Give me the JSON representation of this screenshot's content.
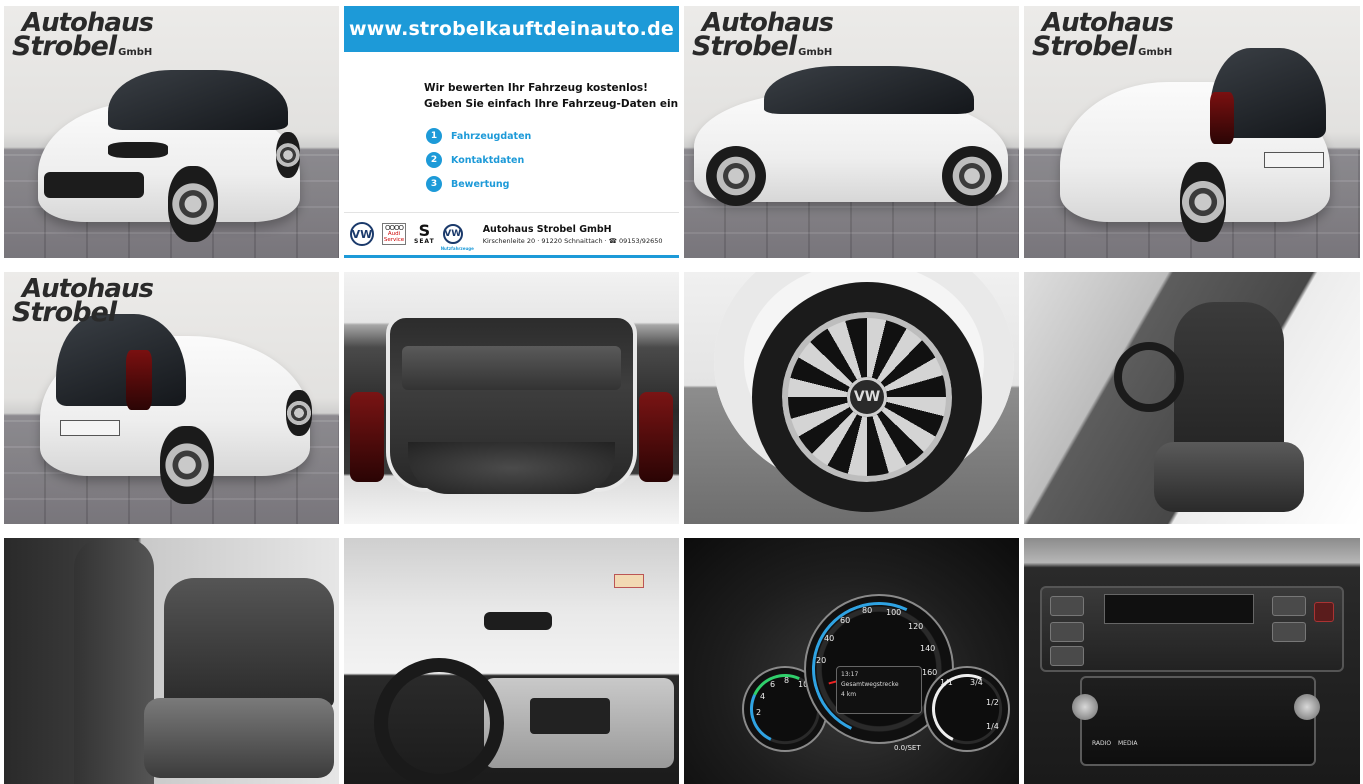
{
  "dealer_logo": {
    "line1": "Autohaus",
    "line2": "Strobel",
    "line3": "GmbH"
  },
  "banner": {
    "url": "www.strobelkauftdeinauto.de",
    "headline_1": "Wir bewerten Ihr Fahrzeug kostenlos!",
    "headline_2": "Geben Sie einfach Ihre Fahrzeug-Daten ein",
    "steps": [
      {
        "num": "1",
        "label": "Fahrzeugdaten"
      },
      {
        "num": "2",
        "label": "Kontaktdaten"
      },
      {
        "num": "3",
        "label": "Bewertung"
      }
    ],
    "brands": {
      "audi_label": "Audi",
      "audi_sub": "Service",
      "seat_label": "SEAT",
      "vwn_label": "Nutzfahrzeuge"
    },
    "dealer_name": "Autohaus Strobel GmbH",
    "dealer_address": "Kirschenleite 20 · 91220 Schnaittach · ☎ 09153/92650"
  },
  "cluster": {
    "ticks_main": [
      "40",
      "60",
      "80",
      "100",
      "120",
      "140",
      "160",
      "20"
    ],
    "ticks_left": [
      "2",
      "4",
      "6",
      "8",
      "10"
    ],
    "ticks_right": [
      "1/1",
      "3/4",
      "1/2",
      "1/4"
    ],
    "display_time": "13:17",
    "display_label": "Gesamtwegstrecke",
    "display_value": "4 km",
    "knob_label": "0.0/SET"
  },
  "console": {
    "label_radio": "RADIO",
    "label_media": "MEDIA"
  },
  "colors": {
    "accent_blue": "#1d9ad8",
    "vw_blue": "#1b3a6b"
  }
}
